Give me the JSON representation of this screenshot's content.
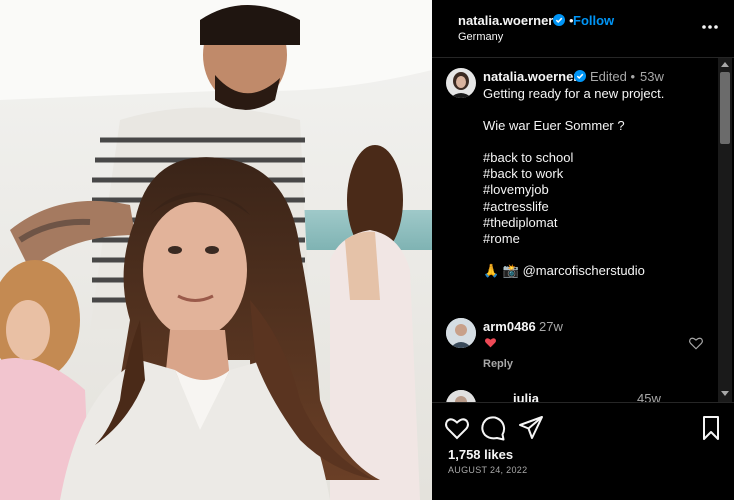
{
  "post": {
    "username": "natalia.woerner",
    "separator": "•",
    "follow_label": "Follow",
    "location": "Germany"
  },
  "caption": {
    "username": "natalia.woerner",
    "edited": "Edited •",
    "time": "53w",
    "lines": [
      "Getting ready for a new project.",
      "",
      "Wie war Euer Sommer ?",
      "",
      "#back to school",
      "#back to work",
      "#lovemyjob",
      "#actresslife",
      "#thediplomat",
      "#rome",
      "",
      "🙏 📸 @marcofischerstudio"
    ]
  },
  "comments": [
    {
      "username": "arm0486",
      "time": "27w",
      "text_icon": "red-heart-icon",
      "reply_label": "Reply"
    },
    {
      "username": "julia",
      "time": "45w"
    }
  ],
  "footer": {
    "likes": "1,758 likes",
    "date": "AUGUST 24, 2022"
  },
  "colors": {
    "accent": "#0095f6",
    "background": "#000000",
    "secondary_text": "#a8a8a8",
    "heart": "#ed4956"
  }
}
